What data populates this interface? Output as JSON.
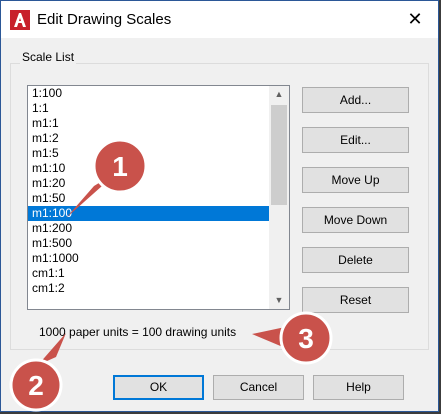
{
  "title": "Edit Drawing Scales",
  "close_glyph": "✕",
  "group_label": "Scale List",
  "scales": [
    "1:100",
    "1:1",
    "m1:1",
    "m1:2",
    "m1:5",
    "m1:10",
    "m1:20",
    "m1:50",
    "m1:100",
    "m1:200",
    "m1:500",
    "m1:1000",
    "cm1:1",
    "cm1:2"
  ],
  "selected_index": 8,
  "buttons": {
    "add": "Add...",
    "edit": "Edit...",
    "move_up": "Move Up",
    "move_down": "Move Down",
    "delete": "Delete",
    "reset": "Reset"
  },
  "status_text": "1000 paper units = 100 drawing units",
  "footer": {
    "ok": "OK",
    "cancel": "Cancel",
    "help": "Help"
  },
  "callouts": {
    "one": "1",
    "two": "2",
    "three": "3"
  },
  "icons": {
    "app": "autocad-a-icon",
    "scroll_up": "▲",
    "scroll_down": "▼"
  },
  "colors": {
    "accent": "#0078d7",
    "callout": "#c9524b",
    "logo": "#c8202c"
  }
}
